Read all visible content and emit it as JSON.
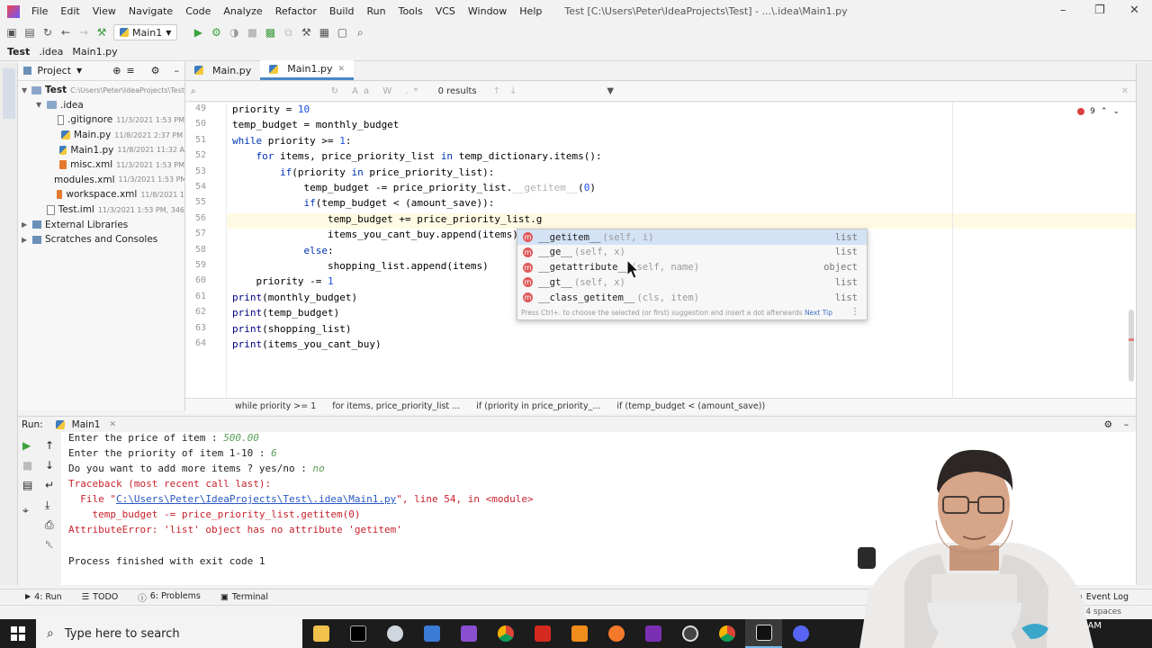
{
  "menu": [
    "File",
    "Edit",
    "View",
    "Navigate",
    "Code",
    "Analyze",
    "Refactor",
    "Build",
    "Run",
    "Tools",
    "VCS",
    "Window",
    "Help"
  ],
  "window_title": "Test [C:\\Users\\Peter\\IdeaProjects\\Test] - ...\\.idea\\Main1.py",
  "run_config": "Main1",
  "nav": {
    "project": "Test",
    "folder": ".idea",
    "file": "Main1.py"
  },
  "project_panel": {
    "title": "Project",
    "tree": [
      {
        "label": "Test",
        "meta": "C:\\Users\\Peter\\IdeaProjects\\Test",
        "type": "folder",
        "indent": 0
      },
      {
        "label": ".idea",
        "meta": "",
        "type": "folder",
        "indent": 1
      },
      {
        "label": ".gitignore",
        "meta": "11/3/2021 1:53 PM",
        "type": "file",
        "indent": 2
      },
      {
        "label": "Main.py",
        "meta": "11/8/2021 2:37 PM",
        "type": "py",
        "indent": 2
      },
      {
        "label": "Main1.py",
        "meta": "11/8/2021 11:32 A",
        "type": "py",
        "indent": 2
      },
      {
        "label": "misc.xml",
        "meta": "11/3/2021 1:53 PM",
        "type": "xml",
        "indent": 2
      },
      {
        "label": "modules.xml",
        "meta": "11/3/2021 1:53 PM",
        "type": "xml",
        "indent": 2
      },
      {
        "label": "workspace.xml",
        "meta": "11/8/2021 1",
        "type": "xml",
        "indent": 2
      },
      {
        "label": "Test.iml",
        "meta": "11/3/2021 1:53 PM, 346",
        "type": "file",
        "indent": 1
      },
      {
        "label": "External Libraries",
        "meta": "",
        "type": "lib",
        "indent": 0
      },
      {
        "label": "Scratches and Consoles",
        "meta": "",
        "type": "lib",
        "indent": 0
      }
    ]
  },
  "tabs": [
    {
      "label": "Main.py"
    },
    {
      "label": "Main1.py"
    }
  ],
  "search": {
    "results": "0 results"
  },
  "inspection_count": "9",
  "editor": {
    "lines": [
      {
        "n": "49",
        "text": "priority = 10"
      },
      {
        "n": "50",
        "text": "temp_budget = monthly_budget"
      },
      {
        "n": "51",
        "text": "while priority >= 1:"
      },
      {
        "n": "52",
        "text": "    for items, price_priority_list in temp_dictionary.items():"
      },
      {
        "n": "53",
        "text": "        if(priority in price_priority_list):"
      },
      {
        "n": "54",
        "text": "            temp_budget -= price_priority_list.__getitem__(0)"
      },
      {
        "n": "55",
        "text": "            if(temp_budget < (amount_save)):"
      },
      {
        "n": "56",
        "text": "                temp_budget += price_priority_list.g"
      },
      {
        "n": "57",
        "text": "                items_you_cant_buy.append(items)"
      },
      {
        "n": "58",
        "text": "            else:"
      },
      {
        "n": "59",
        "text": "                shopping_list.append(items)"
      },
      {
        "n": "60",
        "text": "    priority -= 1"
      },
      {
        "n": "61",
        "text": "print(monthly_budget)"
      },
      {
        "n": "62",
        "text": "print(temp_budget)"
      },
      {
        "n": "63",
        "text": "print(shopping_list)"
      },
      {
        "n": "64",
        "text": "print(items_you_cant_buy)"
      }
    ]
  },
  "completion": {
    "items": [
      {
        "name": "__getitem__",
        "sig": "(self, i)",
        "type": "list"
      },
      {
        "name": "__ge__",
        "sig": "(self, x)",
        "type": "list"
      },
      {
        "name": "__getattribute__",
        "sig": "(self, name)",
        "type": "object"
      },
      {
        "name": "__gt__",
        "sig": "(self, x)",
        "type": "list"
      },
      {
        "name": "__class_getitem__",
        "sig": "(cls, item)",
        "type": "list"
      }
    ],
    "tip": "Press Ctrl+. to choose the selected (or first) suggestion and insert a dot afterwards",
    "next_tip": "Next Tip"
  },
  "breadcrumb": [
    "while priority >= 1",
    "for items, price_priority_list ...",
    "if (priority in price_priority_...",
    "if (temp_budget < (amount_save))"
  ],
  "run": {
    "label": "Run:",
    "config": "Main1",
    "console": {
      "l1_a": "Enter the price of item : ",
      "l1_b": "500.00",
      "l2_a": "Enter the priority of item 1-10 : ",
      "l2_b": "6",
      "l3_a": "Do you want to add more items ? yes/no : ",
      "l3_b": "no",
      "l4": "Traceback (most recent call last):",
      "l5_a": "  File \"",
      "l5_link": "C:\\Users\\Peter\\IdeaProjects\\Test\\.idea\\Main1.py",
      "l5_b": "\", line 54, in <module>",
      "l6": "    temp_budget -= price_priority_list.getitem(0)",
      "l7": "AttributeError: 'list' object has no attribute 'getitem'",
      "l8": "Process finished with exit code 1"
    }
  },
  "bottom_tabs": {
    "run": "4: Run",
    "todo": "TODO",
    "problems": "6: Problems",
    "terminal": "Terminal",
    "event_log": "Event Log"
  },
  "status": {
    "indent": "4 spaces",
    "time": "AM"
  },
  "taskbar": {
    "search_placeholder": "Type here to search"
  },
  "colors": {
    "accent": "#4a88c7",
    "error": "#c7222d",
    "keyword": "#0033b3"
  }
}
